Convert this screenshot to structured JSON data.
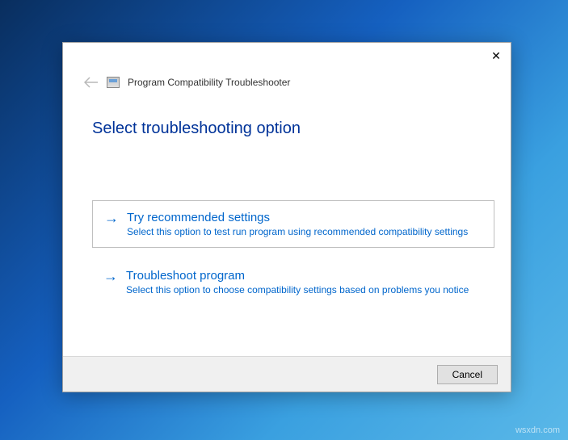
{
  "header": {
    "title": "Program Compatibility Troubleshooter"
  },
  "heading": "Select troubleshooting option",
  "options": [
    {
      "title": "Try recommended settings",
      "description": "Select this option to test run program using recommended compatibility settings"
    },
    {
      "title": "Troubleshoot program",
      "description": "Select this option to choose compatibility settings based on problems you notice"
    }
  ],
  "footer": {
    "cancel_label": "Cancel"
  },
  "watermark": "wsxdn.com"
}
